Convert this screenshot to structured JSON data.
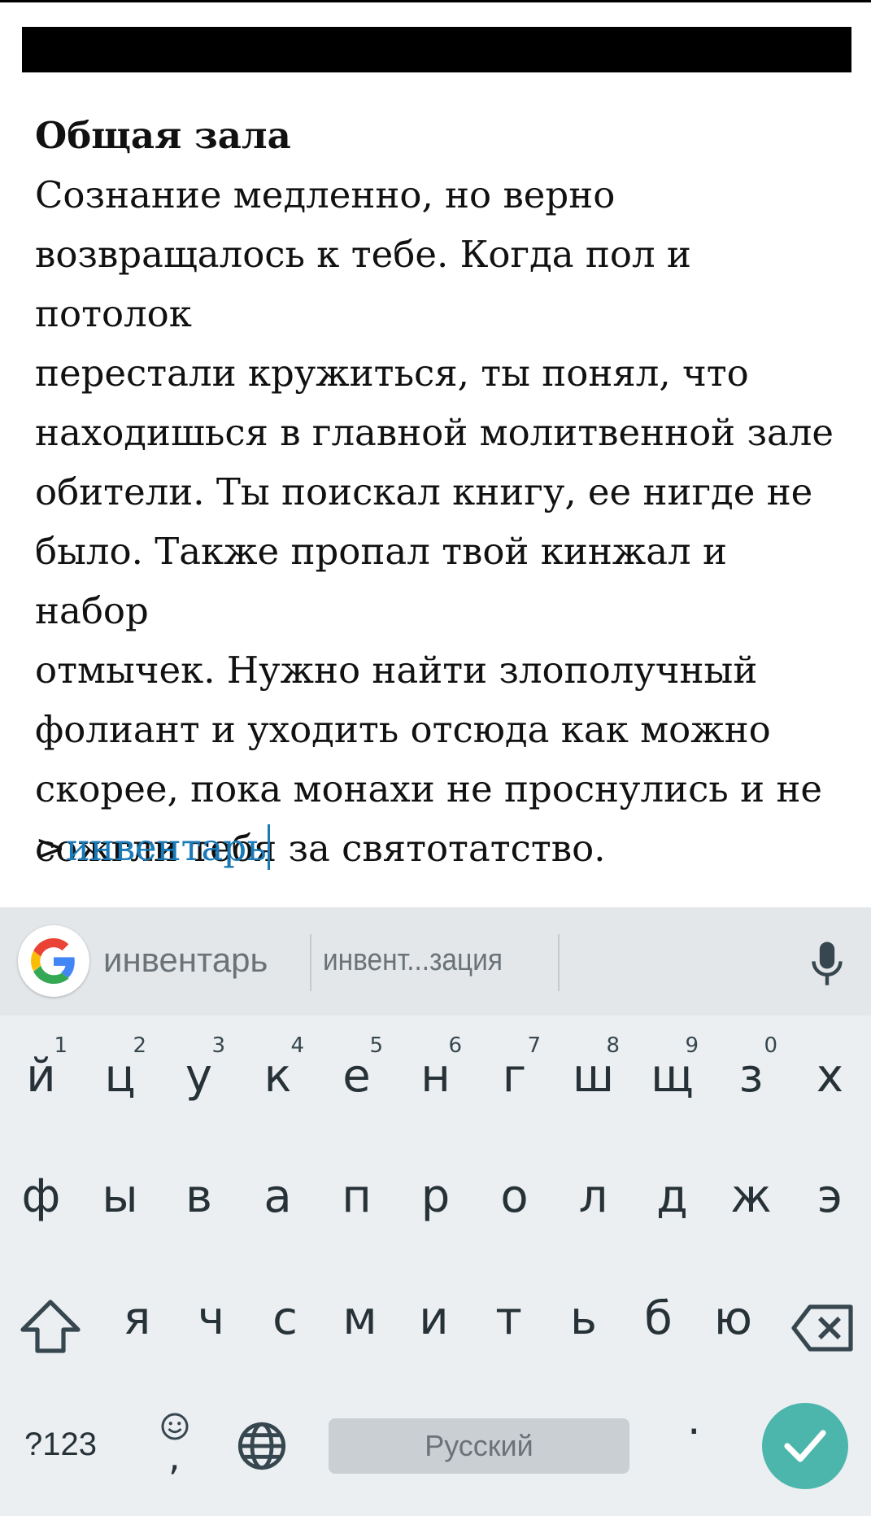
{
  "header": {
    "title": "Общая зала"
  },
  "story": {
    "room_title": "Общая зала",
    "lines": [
      "Сознание медленно, но верно",
      "возвращалось к тебе. Когда пол и потолок",
      "перестали кружиться, ты понял, что",
      "находишься в главной молитвенной зале",
      "обители. Ты поискал книгу, ее нигде не",
      "было. Также пропал твой кинжал и набор",
      "отмычек. Нужно найти злополучный",
      "фолиант и уходить отсюда как можно",
      "скорее, пока монахи не проснулись и не",
      "сожгли тебя за святотатство."
    ]
  },
  "prompt": {
    "symbol": ">",
    "input_value": "инвентарь"
  },
  "keyboard": {
    "suggestions": [
      "инвентарь",
      "инвент...зация"
    ],
    "row1": [
      {
        "ch": "й",
        "hint": "1"
      },
      {
        "ch": "ц",
        "hint": "2"
      },
      {
        "ch": "у",
        "hint": "3"
      },
      {
        "ch": "к",
        "hint": "4"
      },
      {
        "ch": "е",
        "hint": "5"
      },
      {
        "ch": "н",
        "hint": "6"
      },
      {
        "ch": "г",
        "hint": "7"
      },
      {
        "ch": "ш",
        "hint": "8"
      },
      {
        "ch": "щ",
        "hint": "9"
      },
      {
        "ch": "з",
        "hint": "0"
      },
      {
        "ch": "х",
        "hint": ""
      }
    ],
    "row2": [
      "ф",
      "ы",
      "в",
      "а",
      "п",
      "р",
      "о",
      "л",
      "д",
      "ж",
      "э"
    ],
    "row3": [
      "я",
      "ч",
      "с",
      "м",
      "и",
      "т",
      "ь",
      "б",
      "ю"
    ],
    "symbols_label": "?123",
    "emoji_comma": ",",
    "space_label": "Русский",
    "period": ".",
    "colors": {
      "accent": "#4db6ac",
      "input_text": "#1a7ab8",
      "key_text": "#263238"
    }
  }
}
